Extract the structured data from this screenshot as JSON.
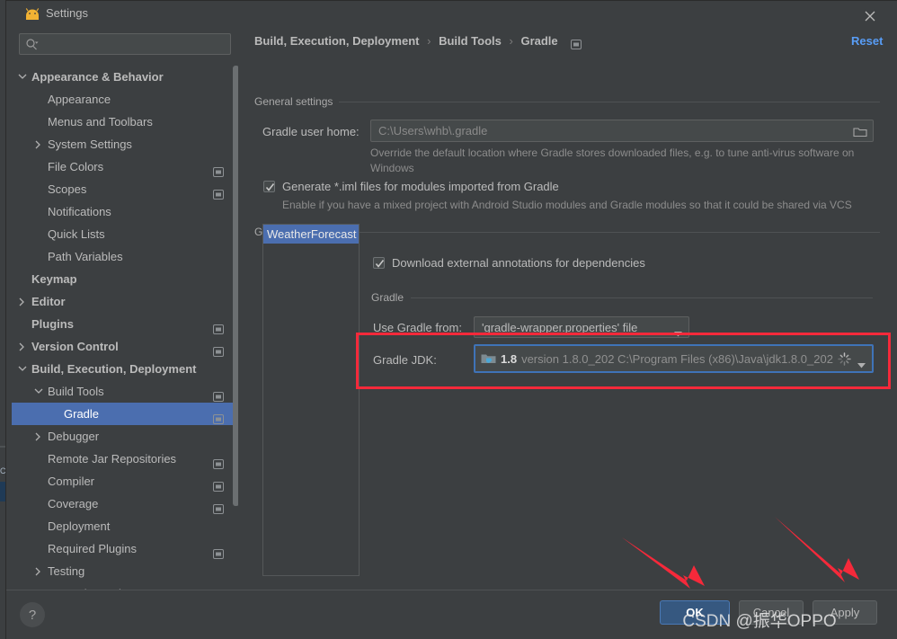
{
  "window": {
    "title": "Settings",
    "icon": "android-studio-icon",
    "close_icon": "close-icon"
  },
  "search": {
    "value": "",
    "placeholder": "",
    "icon": "search-icon"
  },
  "sidebar": {
    "items": [
      {
        "label": "Appearance & Behavior",
        "level": 0,
        "bold": true,
        "twisty": "chevron-down",
        "badge": false,
        "selected": false
      },
      {
        "label": "Appearance",
        "level": 1,
        "bold": false,
        "twisty": "none",
        "badge": false,
        "selected": false
      },
      {
        "label": "Menus and Toolbars",
        "level": 1,
        "bold": false,
        "twisty": "none",
        "badge": false,
        "selected": false
      },
      {
        "label": "System Settings",
        "level": 1,
        "bold": false,
        "twisty": "chevron-right",
        "badge": false,
        "selected": false
      },
      {
        "label": "File Colors",
        "level": 1,
        "bold": false,
        "twisty": "none",
        "badge": true,
        "selected": false
      },
      {
        "label": "Scopes",
        "level": 1,
        "bold": false,
        "twisty": "none",
        "badge": true,
        "selected": false
      },
      {
        "label": "Notifications",
        "level": 1,
        "bold": false,
        "twisty": "none",
        "badge": false,
        "selected": false
      },
      {
        "label": "Quick Lists",
        "level": 1,
        "bold": false,
        "twisty": "none",
        "badge": false,
        "selected": false
      },
      {
        "label": "Path Variables",
        "level": 1,
        "bold": false,
        "twisty": "none",
        "badge": false,
        "selected": false
      },
      {
        "label": "Keymap",
        "level": 0,
        "bold": true,
        "twisty": "none",
        "badge": false,
        "selected": false
      },
      {
        "label": "Editor",
        "level": 0,
        "bold": true,
        "twisty": "chevron-right",
        "badge": false,
        "selected": false
      },
      {
        "label": "Plugins",
        "level": 0,
        "bold": true,
        "twisty": "none",
        "badge": true,
        "selected": false
      },
      {
        "label": "Version Control",
        "level": 0,
        "bold": true,
        "twisty": "chevron-right",
        "badge": true,
        "selected": false
      },
      {
        "label": "Build, Execution, Deployment",
        "level": 0,
        "bold": true,
        "twisty": "chevron-down",
        "badge": false,
        "selected": false
      },
      {
        "label": "Build Tools",
        "level": 1,
        "bold": false,
        "twisty": "chevron-down",
        "badge": true,
        "selected": false
      },
      {
        "label": "Gradle",
        "level": 2,
        "bold": false,
        "twisty": "none",
        "badge": true,
        "selected": true
      },
      {
        "label": "Debugger",
        "level": 1,
        "bold": false,
        "twisty": "chevron-right",
        "badge": false,
        "selected": false
      },
      {
        "label": "Remote Jar Repositories",
        "level": 1,
        "bold": false,
        "twisty": "none",
        "badge": true,
        "selected": false
      },
      {
        "label": "Compiler",
        "level": 1,
        "bold": false,
        "twisty": "none",
        "badge": true,
        "selected": false
      },
      {
        "label": "Coverage",
        "level": 1,
        "bold": false,
        "twisty": "none",
        "badge": true,
        "selected": false
      },
      {
        "label": "Deployment",
        "level": 1,
        "bold": false,
        "twisty": "none",
        "badge": false,
        "selected": false
      },
      {
        "label": "Required Plugins",
        "level": 1,
        "bold": false,
        "twisty": "none",
        "badge": true,
        "selected": false
      },
      {
        "label": "Testing",
        "level": 1,
        "bold": false,
        "twisty": "chevron-right",
        "badge": false,
        "selected": false
      },
      {
        "label": "Trusted Locations",
        "level": 1,
        "bold": false,
        "twisty": "none",
        "badge": false,
        "selected": false
      }
    ]
  },
  "header": {
    "breadcrumb": [
      "Build, Execution, Deployment",
      "Build Tools",
      "Gradle"
    ],
    "breadcrumb_separator": "›",
    "reset_label": "Reset"
  },
  "general_settings": {
    "section_title": "General settings",
    "gradle_user_home_label": "Gradle user home:",
    "gradle_user_home_value": "C:\\Users\\whb\\.gradle",
    "gradle_user_home_hint": "Override the default location where Gradle stores downloaded files, e.g. to tune anti-virus software on Windows",
    "browse_icon": "folder-icon",
    "generate_iml_label": "Generate *.iml files for modules imported from Gradle",
    "generate_iml_checked": true,
    "generate_iml_hint": "Enable if you have a mixed project with Android Studio modules and Gradle modules so that it could be shared via VCS"
  },
  "gradle_projects": {
    "section_title": "Gradle projects",
    "projects": [
      "WeatherForecast"
    ],
    "selected_project": "WeatherForecast",
    "download_annotations_label": "Download external annotations for dependencies",
    "download_annotations_checked": true,
    "gradle_subsection_title": "Gradle",
    "use_gradle_from_label": "Use Gradle from:",
    "use_gradle_from_value": "'gradle-wrapper.properties' file",
    "gradle_jdk_label": "Gradle JDK:",
    "gradle_jdk_version": "1.8",
    "gradle_jdk_description": "version 1.8.0_202 C:\\Program Files (x86)\\Java\\jdk1.8.0_202",
    "gradle_jdk_icon": "jdk-folder-icon",
    "gradle_jdk_spinner_icon": "loading-spinner-icon"
  },
  "footer": {
    "help_label": "?",
    "ok_label": "OK",
    "cancel_label": "Cancel",
    "apply_label": "Apply"
  },
  "annotations": {
    "highlight_color": "#f5293a",
    "arrow_color": "#f5293a",
    "watermark": "CSDN @振华OPPO"
  },
  "colors": {
    "accent_blue": "#4b6eaf",
    "link_blue": "#589df6",
    "panel_bg": "#3c3f41",
    "field_bg": "#45494a",
    "focus_border": "#3f73b8"
  }
}
